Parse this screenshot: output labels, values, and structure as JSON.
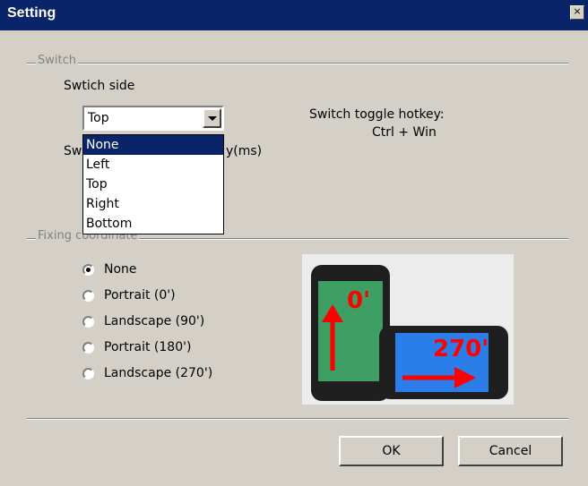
{
  "window": {
    "title": "Setting",
    "close_glyph": "×"
  },
  "switch_group": {
    "label": "Switch",
    "side_label": "Swtich side",
    "side_value": "Top",
    "delay_label_left": "Sw",
    "delay_label_right": "y(ms)",
    "hotkey_label": "Switch toggle hotkey:",
    "hotkey_value": "Ctrl + Win",
    "options": [
      "None",
      "Left",
      "Top",
      "Right",
      "Bottom"
    ],
    "highlighted_option": "None"
  },
  "fixing_group": {
    "label": "Fixing coordinate",
    "radios": [
      {
        "label": "None",
        "checked": true
      },
      {
        "label": "Portrait (0')",
        "checked": false
      },
      {
        "label": "Landscape (90')",
        "checked": false
      },
      {
        "label": "Portrait (180')",
        "checked": false
      },
      {
        "label": "Landscape (270')",
        "checked": false
      }
    ],
    "preview": {
      "portrait_label": "0'",
      "landscape_label": "270'",
      "colors": {
        "portrait_screen": "#3e9e63",
        "landscape_screen": "#2b7de9",
        "arrow": "#ff0000"
      }
    }
  },
  "buttons": {
    "ok": "OK",
    "cancel": "Cancel"
  }
}
